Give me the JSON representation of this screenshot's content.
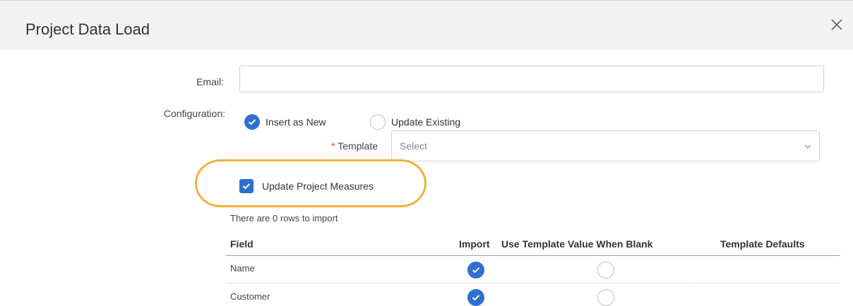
{
  "dialog": {
    "title": "Project Data Load"
  },
  "form": {
    "email_label": "Email:",
    "email_value": "",
    "configuration_label": "Configuration:",
    "options": [
      {
        "label": "Insert as New",
        "selected": true
      },
      {
        "label": "Update Existing",
        "selected": false
      }
    ],
    "template_required_mark": "*",
    "template_label": "Template",
    "template_placeholder": "Select",
    "update_measures_label": "Update Project Measures",
    "update_measures_checked": true
  },
  "import": {
    "summary": "There are 0 rows to import",
    "columns": [
      "Field",
      "Import",
      "Use Template Value When Blank",
      "Template Defaults"
    ],
    "rows": [
      {
        "field": "Name",
        "import": true,
        "use_template_when_blank": false
      },
      {
        "field": "Customer",
        "import": true,
        "use_template_when_blank": false
      }
    ]
  },
  "colors": {
    "accent": "#2f6fcf",
    "highlight": "#f0b23a",
    "required": "#e03e2d"
  }
}
